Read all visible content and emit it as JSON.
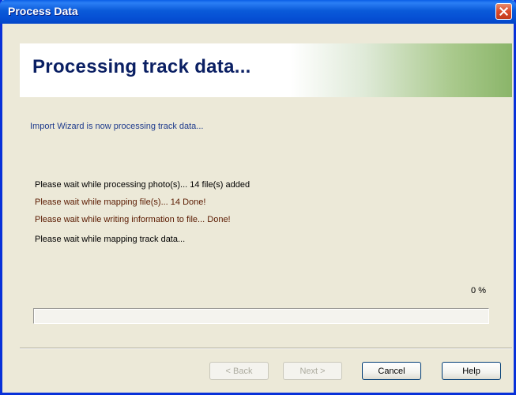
{
  "window": {
    "title": "Process Data",
    "close_icon": "close-icon"
  },
  "header": {
    "title": "Processing track data..."
  },
  "intro": "Import Wizard is now processing track data...",
  "status_lines": [
    "Please wait while processing photo(s)... 14 file(s) added",
    "Please wait while mapping file(s)... 14 Done!",
    "Please wait while writing information to file... Done!",
    "Please wait while mapping track data..."
  ],
  "progress": {
    "label": "0 %",
    "value_percent": 0
  },
  "buttons": {
    "back": "< Back",
    "next": "Next >",
    "cancel": "Cancel",
    "help": "Help"
  },
  "colors": {
    "titlebar": "#0a5ad9",
    "close_button": "#d9492a",
    "header_text": "#0a1f63",
    "intro_text": "#1d3a8c",
    "status_dark_red": "#5a1a00",
    "dialog_background": "#ece9d8"
  }
}
